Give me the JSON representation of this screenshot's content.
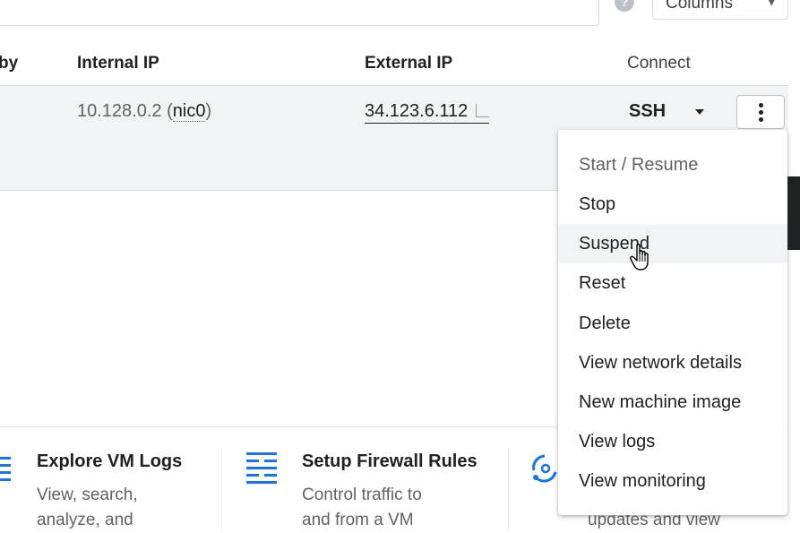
{
  "toolbar": {
    "help_glyph": "?",
    "columns_label": "Columns",
    "columns_chevron": "▾"
  },
  "table": {
    "headers": {
      "partial": "by",
      "internal_ip": "Internal IP",
      "external_ip": "External IP",
      "connect": "Connect"
    },
    "row": {
      "internal_ip": "10.128.0.2",
      "nic": "nic0",
      "external_ip": "34.123.6.112",
      "connect": "SSH"
    }
  },
  "menu": {
    "items": [
      {
        "label": "Start / Resume",
        "disabled": true
      },
      {
        "label": "Stop"
      },
      {
        "label": "Suspend",
        "hovered": true
      },
      {
        "label": "Reset"
      },
      {
        "label": "Delete"
      },
      {
        "label": "View network details"
      },
      {
        "label": "New machine image"
      },
      {
        "label": "View logs"
      },
      {
        "label": "View monitoring"
      }
    ]
  },
  "cards": [
    {
      "title": "Explore VM Logs",
      "desc_line1": "View, search,",
      "desc_line2": "analyze, and"
    },
    {
      "title": "Setup Firewall Rules",
      "desc_line1": "Control traffic to",
      "desc_line2": "and from a VM"
    },
    {
      "title": "",
      "desc_line1": "",
      "desc_line2": "updates and view"
    }
  ],
  "colors": {
    "accent": "#1a73e8",
    "row_highlight": "#f1f3f4"
  }
}
